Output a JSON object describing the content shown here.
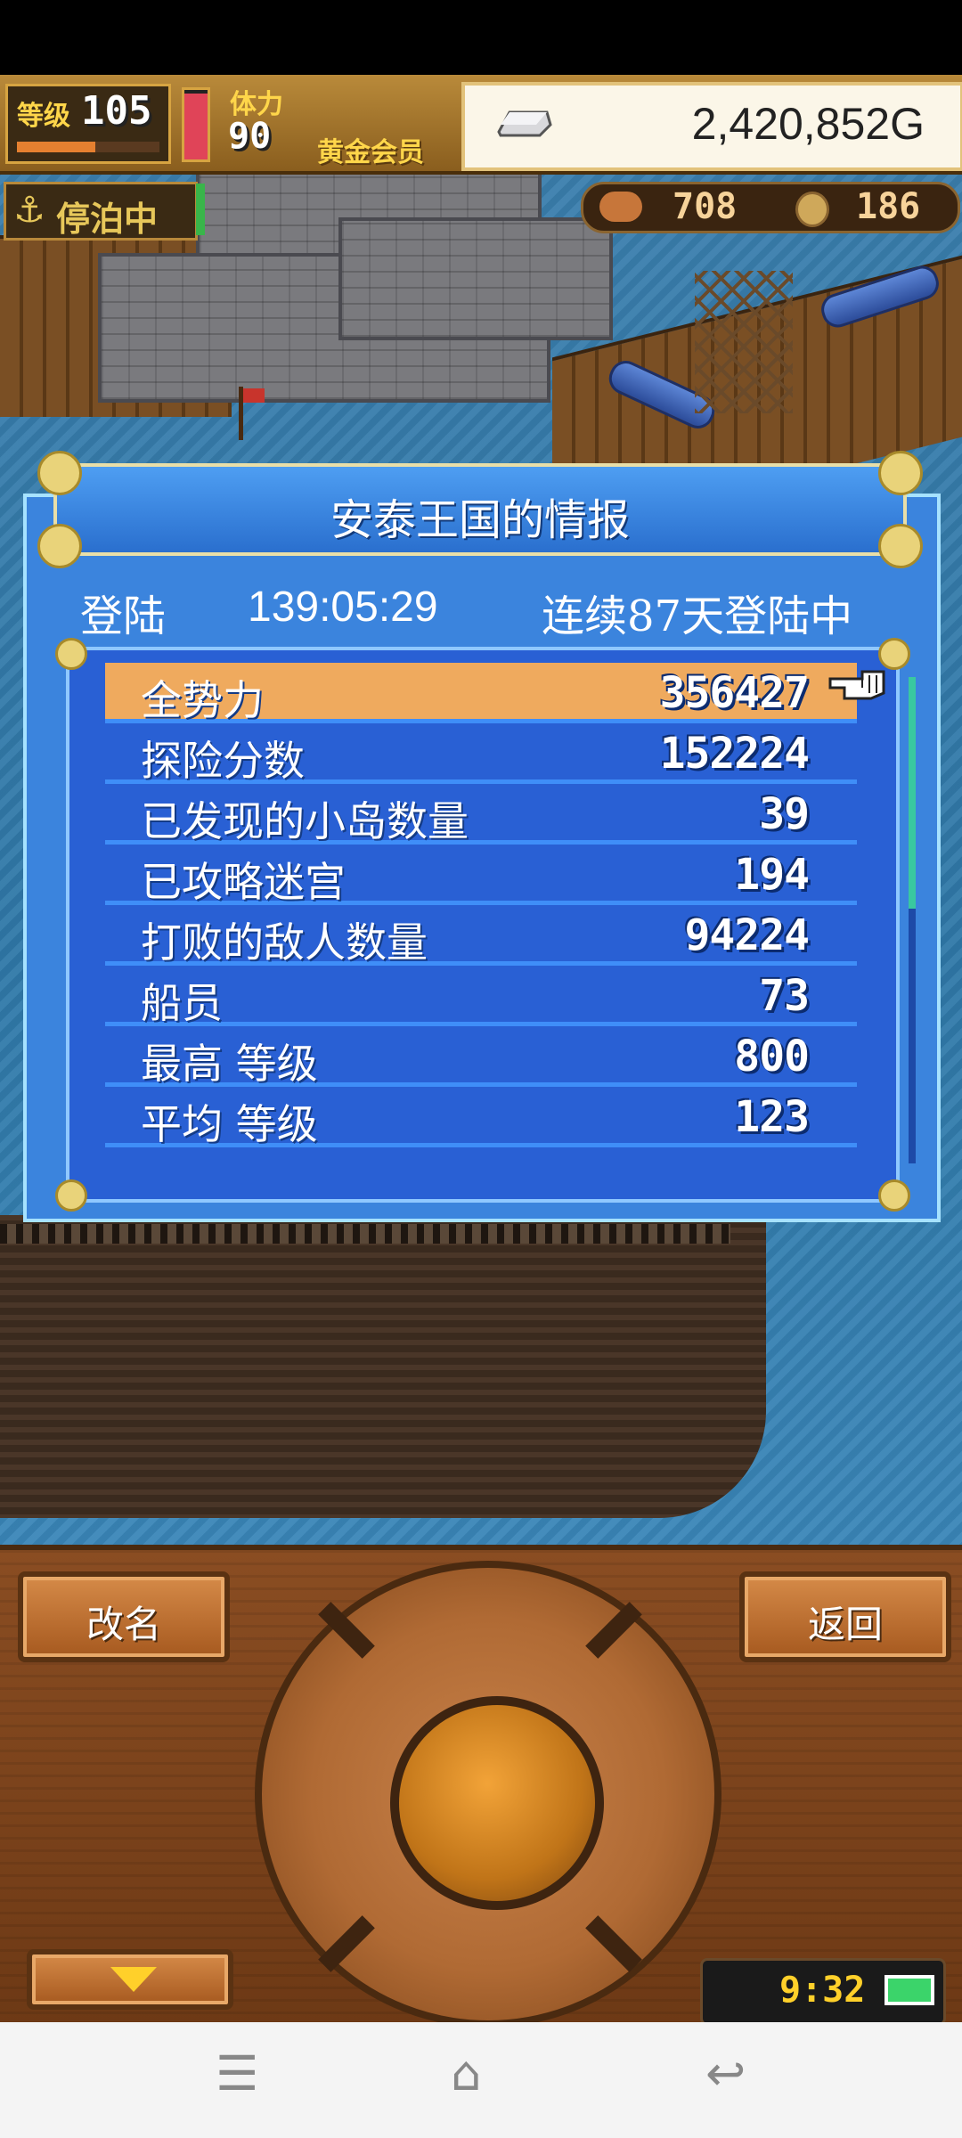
{
  "hud": {
    "level_label": "等级",
    "level_value": "105",
    "level_progress": 0.55,
    "stamina_label": "体力",
    "stamina_value": "90",
    "stamina_gauge_level": 0.95,
    "membership": "黄金会员",
    "gold": "2,420,852G",
    "status_badge": "停泊中",
    "resource_1_icon": "food-icon",
    "resource_1": "708",
    "resource_2_icon": "coin-icon",
    "resource_2": "186"
  },
  "dialog": {
    "title": "安泰王国的情报",
    "login_label": "登陆",
    "login_time": "139:05:29",
    "login_streak": "连续87天登陆中",
    "stats": [
      {
        "label": "全势力",
        "value": "356427"
      },
      {
        "label": "探险分数",
        "value": "152224"
      },
      {
        "label": "已发现的小岛数量",
        "value": "39"
      },
      {
        "label": "已攻略迷宫",
        "value": "194"
      },
      {
        "label": "打败的敌人数量",
        "value": "94224"
      },
      {
        "label": "船员",
        "value": "73"
      },
      {
        "label": "最高 等级",
        "value": "800"
      },
      {
        "label": "平均 等级",
        "value": "123"
      }
    ],
    "selected_index": 0,
    "scroll_position": 0.0
  },
  "controls": {
    "rename_label": "改名",
    "back_label": "返回",
    "clock": "9:32",
    "battery_level": 1.0
  },
  "colors": {
    "dialog_bg": "#3b84dd",
    "row_selected": "#efaa5e",
    "gold_text": "#ffd64a",
    "wood": "#8a4d22"
  }
}
